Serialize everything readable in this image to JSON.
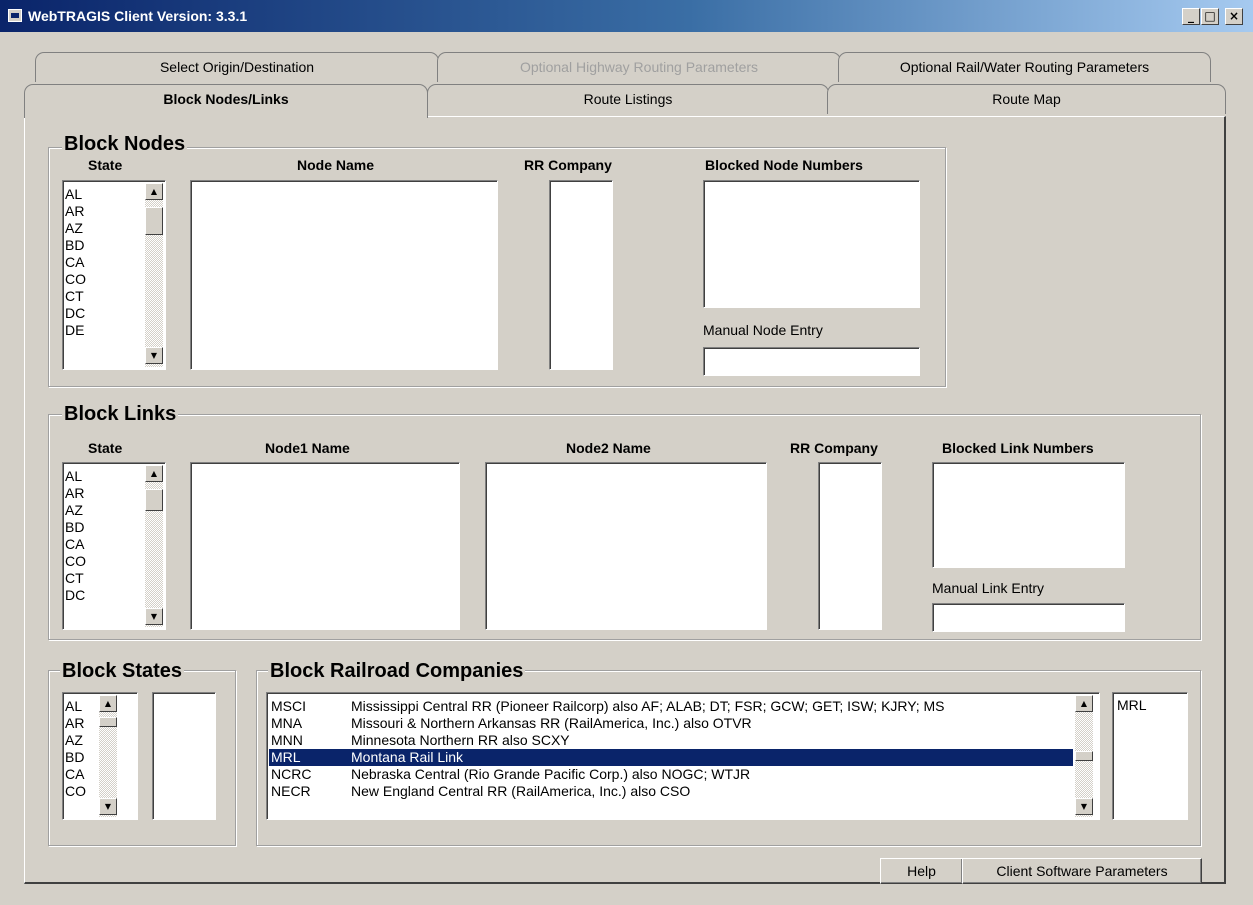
{
  "window": {
    "title": "WebTRAGIS Client Version: 3.3.1",
    "minimize_glyph": "_",
    "maximize_glyph": "□",
    "close_glyph": "×"
  },
  "tabs": {
    "back_row": [
      {
        "label": "Select Origin/Destination",
        "enabled": true
      },
      {
        "label": "Optional Highway Routing Parameters",
        "enabled": false
      },
      {
        "label": "Optional Rail/Water Routing Parameters",
        "enabled": true
      }
    ],
    "front_row": [
      {
        "label": "Block Nodes/Links",
        "active": true
      },
      {
        "label": "Route Listings",
        "active": false
      },
      {
        "label": "Route Map",
        "active": false
      }
    ]
  },
  "block_nodes": {
    "title": "Block Nodes",
    "state_label": "State",
    "node_name_label": "Node Name",
    "rr_company_label": "RR Company",
    "blocked_numbers_label": "Blocked Node Numbers",
    "manual_entry_label": "Manual Node Entry",
    "manual_entry_value": "",
    "states": [
      "AL",
      "AR",
      "AZ",
      "BD",
      "CA",
      "CO",
      "CT",
      "DC",
      "DE"
    ]
  },
  "block_links": {
    "title": "Block Links",
    "state_label": "State",
    "node1_label": "Node1 Name",
    "node2_label": "Node2 Name",
    "rr_company_label": "RR Company",
    "blocked_numbers_label": "Blocked Link Numbers",
    "manual_entry_label": "Manual Link Entry",
    "manual_entry_value": "",
    "states": [
      "AL",
      "AR",
      "AZ",
      "BD",
      "CA",
      "CO",
      "CT",
      "DC"
    ]
  },
  "block_states": {
    "title": "Block States",
    "states": [
      "AL",
      "AR",
      "AZ",
      "BD",
      "CA",
      "CO"
    ]
  },
  "block_railroads": {
    "title": "Block Railroad Companies",
    "rows": [
      {
        "code": "MSCI",
        "name": "Mississippi Central RR (Pioneer Railcorp) also AF; ALAB; DT; FSR; GCW; GET; ISW; KJRY; MS",
        "selected": false
      },
      {
        "code": "MNA",
        "name": "Missouri & Northern Arkansas RR (RailAmerica, Inc.) also OTVR",
        "selected": false
      },
      {
        "code": "MNN",
        "name": "Minnesota Northern RR also SCXY",
        "selected": false
      },
      {
        "code": "MRL",
        "name": "Montana Rail Link",
        "selected": true
      },
      {
        "code": "NCRC",
        "name": "Nebraska Central (Rio Grande Pacific Corp.) also NOGC; WTJR",
        "selected": false
      },
      {
        "code": "NECR",
        "name": "New England Central RR (RailAmerica, Inc.) also CSO",
        "selected": false
      }
    ],
    "blocked": [
      "MRL"
    ]
  },
  "buttons": {
    "help": "Help",
    "client_params": "Client Software Parameters"
  },
  "scroll_glyphs": {
    "up": "▲",
    "down": "▼"
  },
  "colors": {
    "face": "#d4d0c8",
    "selection": "#0a246a",
    "title_start": "#0a246a",
    "title_end": "#a6caf0",
    "disabled_text": "#a0a0a0"
  }
}
